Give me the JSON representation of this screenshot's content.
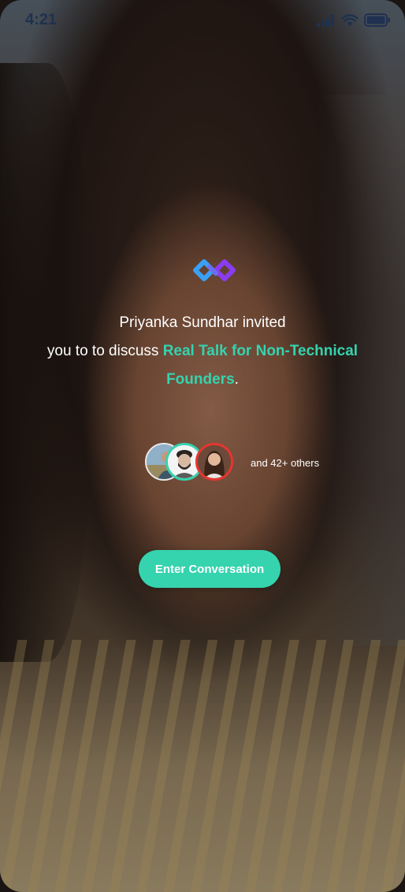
{
  "status_bar": {
    "time": "4:21",
    "icons": [
      "signal-icon",
      "wifi-icon",
      "battery-icon"
    ]
  },
  "invite": {
    "line1": "Priyanka Sundhar invited",
    "line2_prefix": "you to to discuss ",
    "topic_part1": "Real Talk for Non-Technical",
    "topic_part2": "Founders",
    "suffix": "."
  },
  "participants": {
    "others_label": "and 42+ others"
  },
  "actions": {
    "enter_label": "Enter Conversation"
  },
  "colors": {
    "accent": "#35d3ae",
    "logo_blue": "#3aa0f5",
    "logo_purple": "#8a3cf0",
    "status_text": "#1f3150"
  }
}
